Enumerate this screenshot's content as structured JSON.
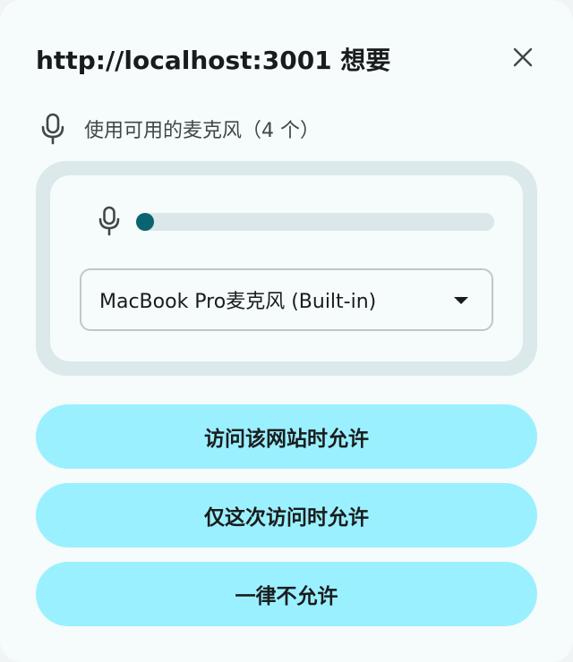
{
  "dialog": {
    "title": "http://localhost:3001 想要",
    "close_icon": "close-icon"
  },
  "permission": {
    "icon": "microphone-icon",
    "label": "使用可用的麦克风（4 个）"
  },
  "device": {
    "level_icon": "microphone-icon",
    "input_level": 0.0,
    "selected_device": "MacBook Pro麦克风 (Built-in)",
    "dropdown_icon": "caret-down-icon"
  },
  "actions": {
    "allow_site": "访问该网站时允许",
    "allow_once": "仅这次访问时允许",
    "never_allow": "一律不允许"
  },
  "colors": {
    "background": "#f6fbfb",
    "panel": "#dbe9ea",
    "accent": "#0a6470",
    "button": "#9bf0ff",
    "text": "#191c1d"
  }
}
